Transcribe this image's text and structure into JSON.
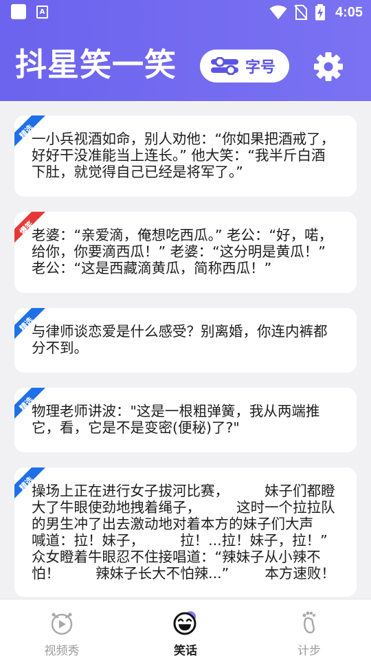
{
  "status_bar": {
    "time": "4:05",
    "left_icons": [
      "notification-square-icon",
      "text-a-icon"
    ],
    "right_icons": [
      "wifi-icon",
      "no-sim-icon",
      "battery-charging-icon"
    ]
  },
  "header": {
    "title": "抖星笑一笑",
    "font_size_button": {
      "label": "字号",
      "icon": "toggle-icon"
    },
    "settings_icon": "gear-icon",
    "background": "#6f66ef"
  },
  "jokes": [
    {
      "tag": "精选",
      "tag_color": "#1f6fe8",
      "text": "一小兵视酒如命，别人劝他：“你如果把酒戒了，\n好好干没准能当上连长。” 他大笑：“我半斤白酒\n下肚，就觉得自己已经是将军了。”"
    },
    {
      "tag": "爆笑",
      "tag_color": "#e53935",
      "text": "老婆：“亲爱滴，俺想吃西瓜。” 老公：“好，喏，\n给你，你要滴西瓜！” 老婆：“这分明是黄瓜！”\n老公：“这是西藏滴黄瓜，简称西瓜！”"
    },
    {
      "tag": "精选",
      "tag_color": "#1f6fe8",
      "text": "与律师谈恋爱是什么感受？别离婚，你连内裤都\n分不到。"
    },
    {
      "tag": "精选",
      "tag_color": "#1f6fe8",
      "text": "物理老师讲波：\"这是一根粗弹簧，我从两端推\n它，看，它是不是变密(便秘)了?\""
    },
    {
      "tag": "精选",
      "tag_color": "#1f6fe8",
      "text": "操场上正在进行女子拔河比赛，        妹子们都瞪\n大了牛眼使劲地拽着绳子，        这时一个拉拉队\n的男生冲了出去激动地对着本方的妹子们大声\n喊道：拉！妹子，        拉！...拉！妹子，拉！”\n众女瞪着牛眼忍不住接唱道：“辣妹子从小辣不\n怕！        辣妹子长大不怕辣...”        本方速败！"
    }
  ],
  "bottom_nav": {
    "items": [
      {
        "label": "视频秀",
        "icon": "video-show-icon",
        "active": false
      },
      {
        "label": "笑话",
        "icon": "laughing-face-icon",
        "active": true
      },
      {
        "label": "计步",
        "icon": "footprint-icon",
        "active": false
      }
    ]
  }
}
